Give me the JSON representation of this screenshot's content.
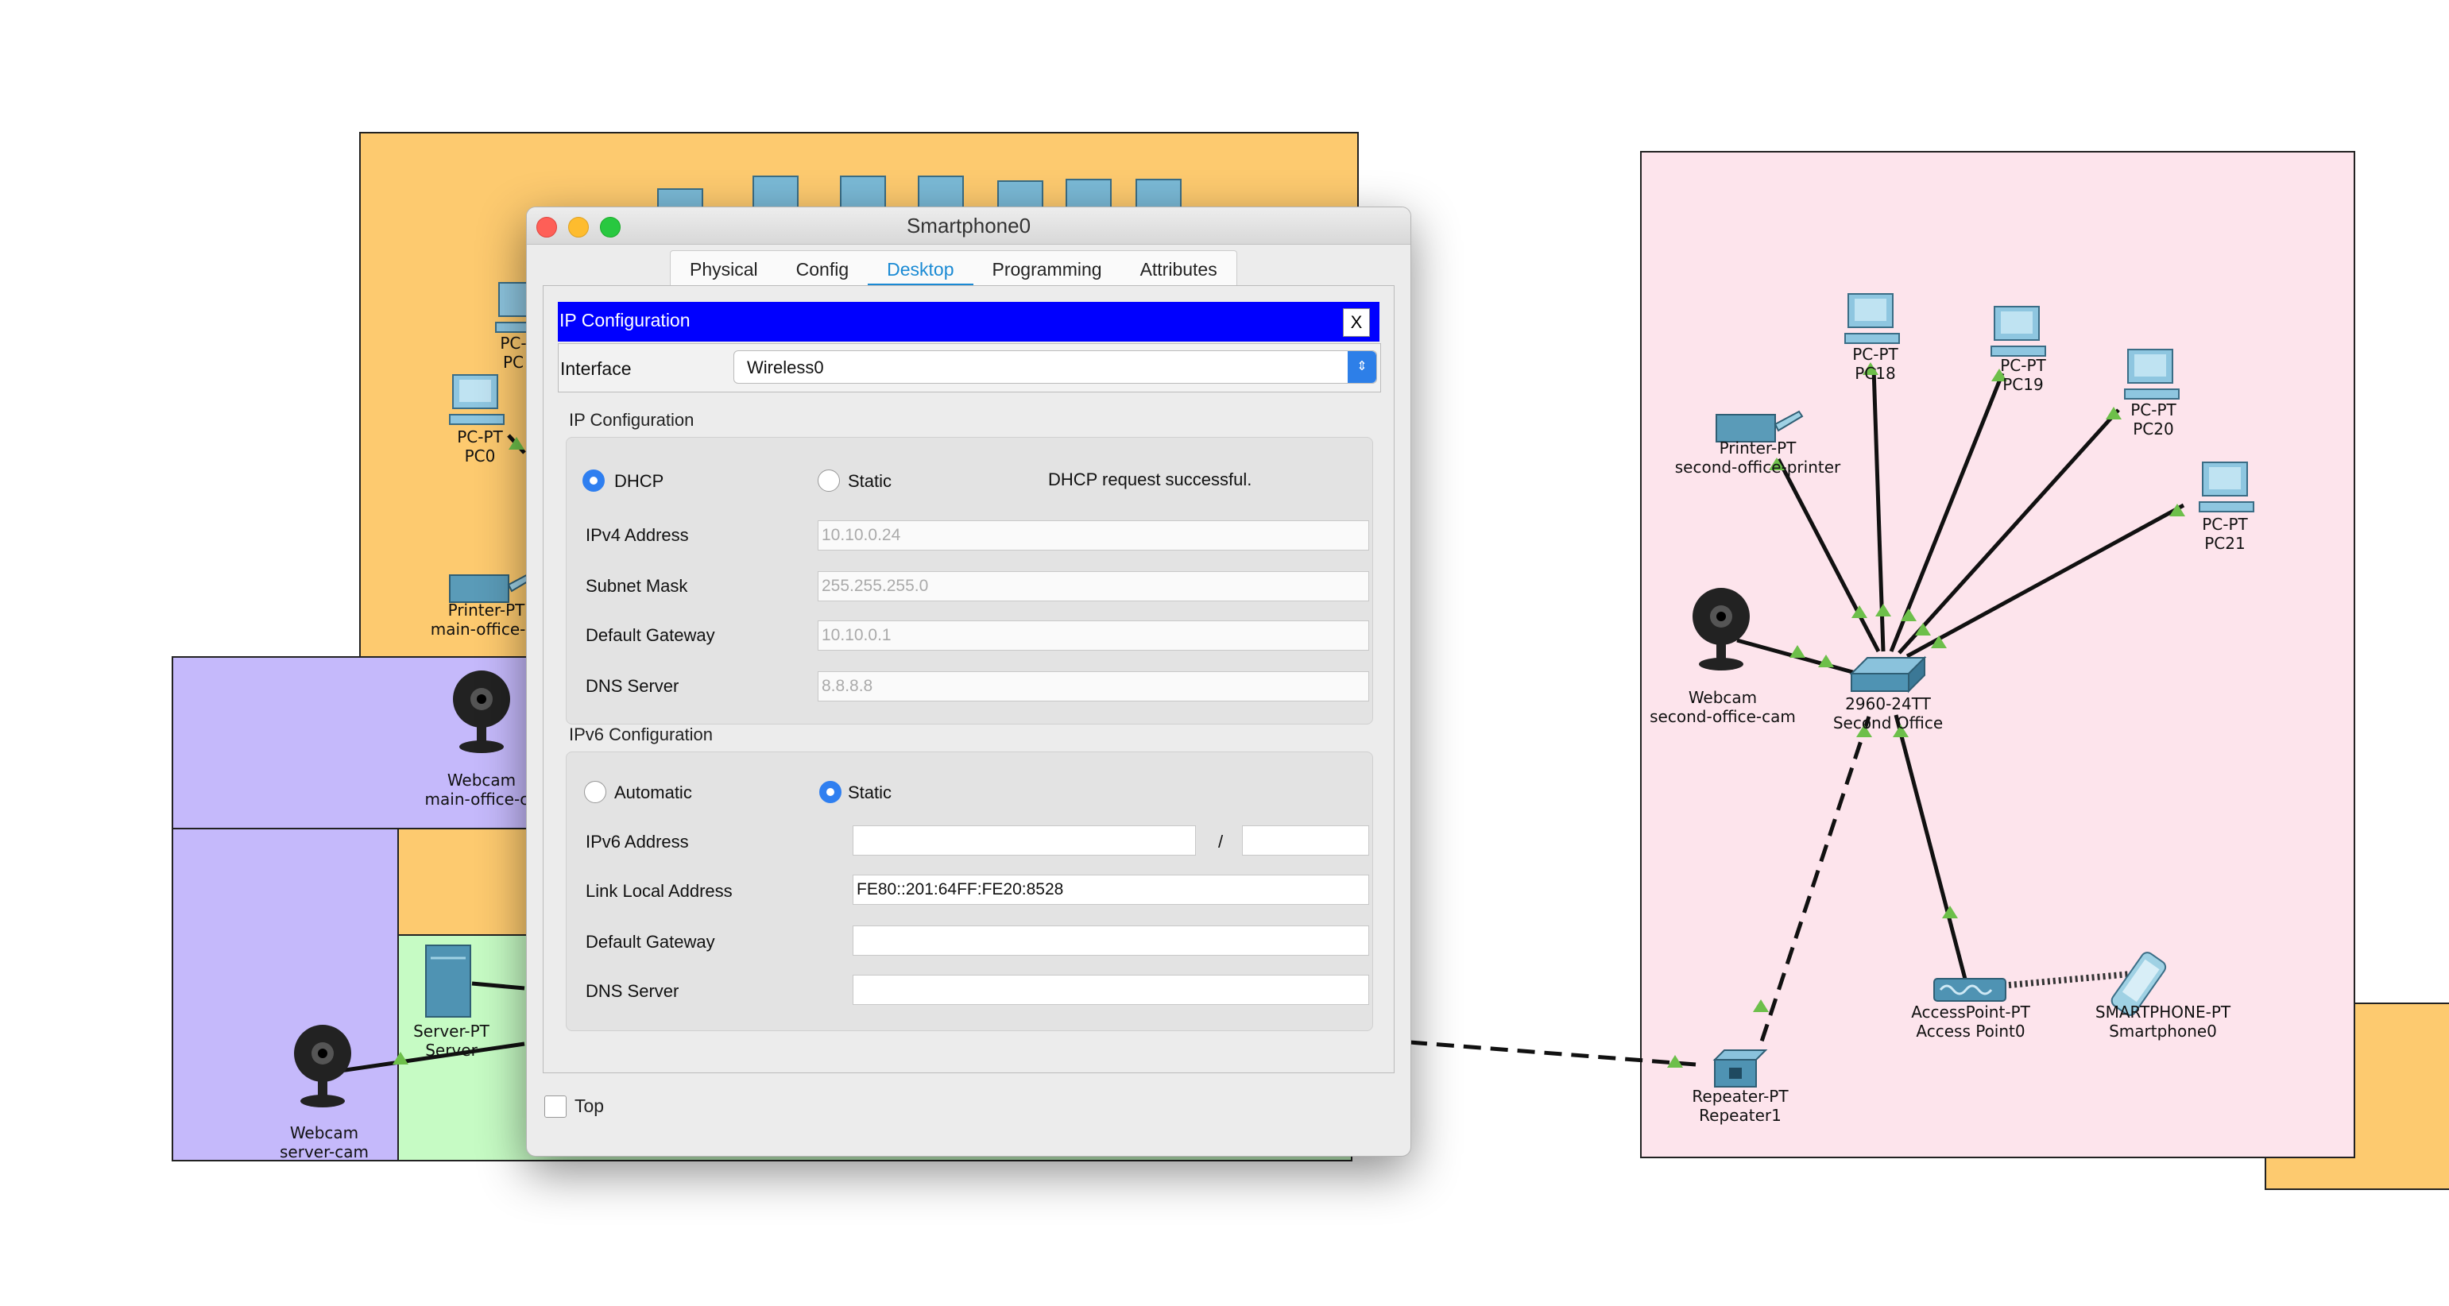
{
  "window": {
    "title": "Smartphone0",
    "tabs": [
      "Physical",
      "Config",
      "Desktop",
      "Programming",
      "Attributes"
    ],
    "active_tab": "Desktop"
  },
  "ip_config": {
    "header": "IP Configuration",
    "close_label": "X",
    "interface_label": "Interface",
    "interface_value": "Wireless0",
    "ipv4_section": "IP Configuration",
    "dhcp_label": "DHCP",
    "static_label": "Static",
    "ipv4_mode": "DHCP",
    "status": "DHCP request successful.",
    "ipv4_address_label": "IPv4 Address",
    "ipv4_address": "10.10.0.24",
    "subnet_label": "Subnet Mask",
    "subnet": "255.255.255.0",
    "gateway_label": "Default Gateway",
    "gateway": "10.10.0.1",
    "dns_label": "DNS Server",
    "dns": "8.8.8.8",
    "ipv6_section": "IPv6 Configuration",
    "automatic_label": "Automatic",
    "static6_label": "Static",
    "ipv6_mode": "Static",
    "ipv6_address_label": "IPv6 Address",
    "ipv6_address": "",
    "ipv6_prefix": "",
    "slash": "/",
    "link_local_label": "Link Local Address",
    "link_local": "FE80::201:64FF:FE20:8528",
    "gateway6_label": "Default Gateway",
    "gateway6": "",
    "dns6_label": "DNS Server",
    "dns6": ""
  },
  "top_checkbox_label": "Top",
  "colors": {
    "main_office": "#fdca6f",
    "camera_zone": "#c5b9fb",
    "server_zone": "#c6fbc4",
    "second_office": "#fde4ec",
    "ip_header": "#0000ff",
    "accent": "#1a8ad4",
    "link_ok": "#6dbf4a"
  },
  "devices": {
    "pc0": [
      "PC-PT",
      "PC0"
    ],
    "pc_partial": [
      "PC-",
      "PC"
    ],
    "main_printer": [
      "Printer-PT",
      "main-office-pr"
    ],
    "main_cam": [
      "Webcam",
      "main-office-ca"
    ],
    "server": [
      "Server-PT",
      "Server"
    ],
    "server_cam": [
      "Webcam",
      "server-cam"
    ],
    "pc18": [
      "PC-PT",
      "PC18"
    ],
    "pc19": [
      "PC-PT",
      "PC19"
    ],
    "pc20": [
      "PC-PT",
      "PC20"
    ],
    "pc21": [
      "PC-PT",
      "PC21"
    ],
    "second_printer": [
      "Printer-PT",
      "second-office-printer"
    ],
    "second_cam": [
      "Webcam",
      "second-office-cam"
    ],
    "switch": [
      "2960-24TT",
      "Second Office"
    ],
    "ap": [
      "AccessPoint-PT",
      "Access Point0"
    ],
    "smartphone": [
      "SMARTPHONE-PT",
      "Smartphone0"
    ],
    "repeater": [
      "Repeater-PT",
      "Repeater1"
    ]
  }
}
